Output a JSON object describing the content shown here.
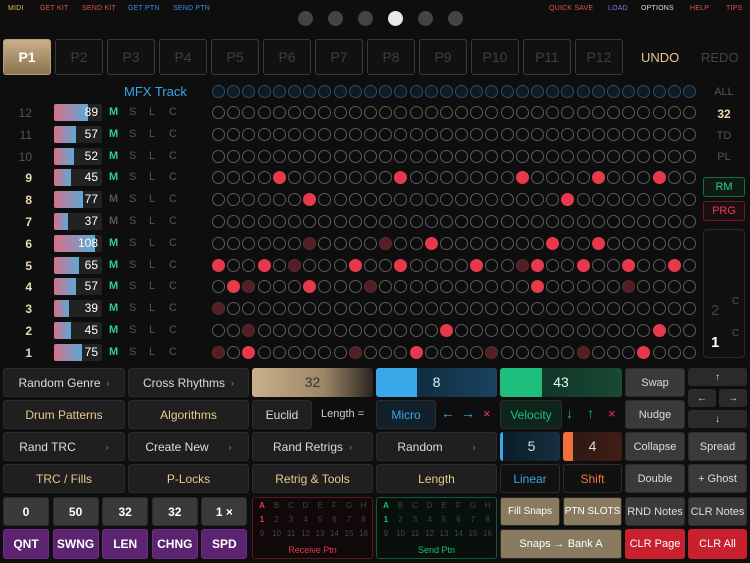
{
  "topbar": {
    "midi": "MIDI",
    "get_kit": "GET KIT",
    "send_kit": "SEND KIT",
    "get_ptn": "GET PTN",
    "send_ptn": "SEND PTN",
    "quick_save": "QUICK SAVE",
    "load": "LOAD",
    "options": "OPTIONS",
    "help": "HELP",
    "tips": "TIPS"
  },
  "page_dots": {
    "count": 6,
    "active": 3
  },
  "patterns": [
    "P1",
    "P2",
    "P3",
    "P4",
    "P5",
    "P6",
    "P7",
    "P8",
    "P9",
    "P10",
    "P11",
    "P12"
  ],
  "selected_pattern": "P1",
  "undo": "UNDO",
  "redo": "REDO",
  "mfx_label": "MFX Track",
  "tracks": [
    {
      "num": "12",
      "value": 89,
      "bold": false,
      "m_on": true
    },
    {
      "num": "11",
      "value": 57,
      "bold": false,
      "m_on": true
    },
    {
      "num": "10",
      "value": 52,
      "bold": false,
      "m_on": true
    },
    {
      "num": "9",
      "value": 45,
      "bold": true,
      "m_on": true
    },
    {
      "num": "8",
      "value": 77,
      "bold": true,
      "m_on": false
    },
    {
      "num": "7",
      "value": 37,
      "bold": true,
      "m_on": false
    },
    {
      "num": "6",
      "value": 108,
      "bold": true,
      "m_on": true
    },
    {
      "num": "5",
      "value": 65,
      "bold": true,
      "m_on": true
    },
    {
      "num": "4",
      "value": 57,
      "bold": true,
      "m_on": true
    },
    {
      "num": "3",
      "value": 39,
      "bold": true,
      "m_on": true
    },
    {
      "num": "2",
      "value": 45,
      "bold": true,
      "m_on": true
    },
    {
      "num": "1",
      "value": 75,
      "bold": true,
      "m_on": true
    }
  ],
  "mslc": [
    "M",
    "S",
    "L",
    "C"
  ],
  "right_panel": {
    "all": "ALL",
    "steps": "32",
    "td": "TD",
    "pl": "PL",
    "rm": "RM",
    "prg": "PRG",
    "slider_a": "2",
    "slider_b": "1",
    "c1": "C",
    "c2": "C"
  },
  "controls": {
    "random_genre": "Random Genre",
    "cross_rhythms": "Cross Rhythms",
    "drum_patterns": "Drum Patterns",
    "algorithms": "Algorithms",
    "rand_trc": "Rand TRC",
    "create_new": "Create New",
    "trc_fills": "TRC / Fills",
    "p_locks": "P-Locks",
    "arrow": "›",
    "len_value": "32",
    "euclid": "Euclid",
    "length_eq": "Length =",
    "rand_retrigs": "Rand Retrigs",
    "retrig_tools": "Retrig & Tools",
    "micro_value": "8",
    "micro": "Micro",
    "random": "Random",
    "length": "Length",
    "vel_value": "43",
    "velocity": "Velocity",
    "linear_value": "5",
    "shift_value": "4",
    "linear": "Linear",
    "shift": "Shift",
    "swap": "Swap",
    "nudge": "Nudge",
    "collapse": "Collapse",
    "spread": "Spread",
    "double": "Double",
    "ghost": "+ Ghost",
    "up": "↑",
    "down": "↓",
    "left": "←",
    "right": "→",
    "x": "×",
    "left_arrow": "←",
    "right_arrow": "→",
    "down_arrow": "↓",
    "up_arrow": "↑",
    "fill_snaps": "Fill Snaps",
    "ptn_slots": "PTN SLOTS",
    "rnd_notes": "RND Notes",
    "clr_notes": "CLR Notes",
    "snaps_bank": "Snaps → Bank A",
    "clr_page": "CLR Page",
    "clr_all": "CLR All",
    "receive_ptn": "Receive Ptn",
    "send_ptn": "Send Ptn"
  },
  "bottom_values": [
    "0",
    "50",
    "32",
    "32",
    "1 ×"
  ],
  "bottom_labels": [
    "QNT",
    "SWNG",
    "LEN",
    "CHNG",
    "SPD"
  ],
  "bank_letters": [
    "A",
    "B",
    "C",
    "D",
    "E",
    "F",
    "G",
    "H"
  ],
  "bank_nums_1": [
    "1",
    "2",
    "3",
    "4",
    "5",
    "6",
    "7",
    "8"
  ],
  "bank_nums_2": [
    "9",
    "10",
    "11",
    "12",
    "13",
    "14",
    "15",
    "16"
  ],
  "colors": {
    "accent_red": "#e63a4c",
    "gold": "#c9b08a",
    "green": "#1dbe7c",
    "blue": "#3aa7e8",
    "purple": "#5c2370"
  },
  "steps": {
    "mfx": "mmmmmmmmmmmmmmmmmmmmmmmmmmmmmmmmmmmmmmmmmmmmmmmmmmmmmmmm",
    "rows": [
      "oooooooooooooooooooooooooooooooooooooooooooooooooooooooooooooooo",
      "oooooooooooooooooooooooooooooooo",
      "oooooooooooooooooooooooooooooooo",
      "oooooororooooooooooooooooooooooo",
      "ooooooorooooooooooooooorooooooooo",
      "oooooooooooooooooooooooooooooooo",
      "ooooooooooooooooooooooooooooooooo",
      "oooooooooooooooooooooooooooooooo",
      "oooooooooooooooooooooooooooooooo",
      "oooooooooooooooooooooooooooooooo",
      "oooooooooooooooooooooooooooooooo",
      "oooooooooooooooooooooooooooooooo"
    ]
  }
}
